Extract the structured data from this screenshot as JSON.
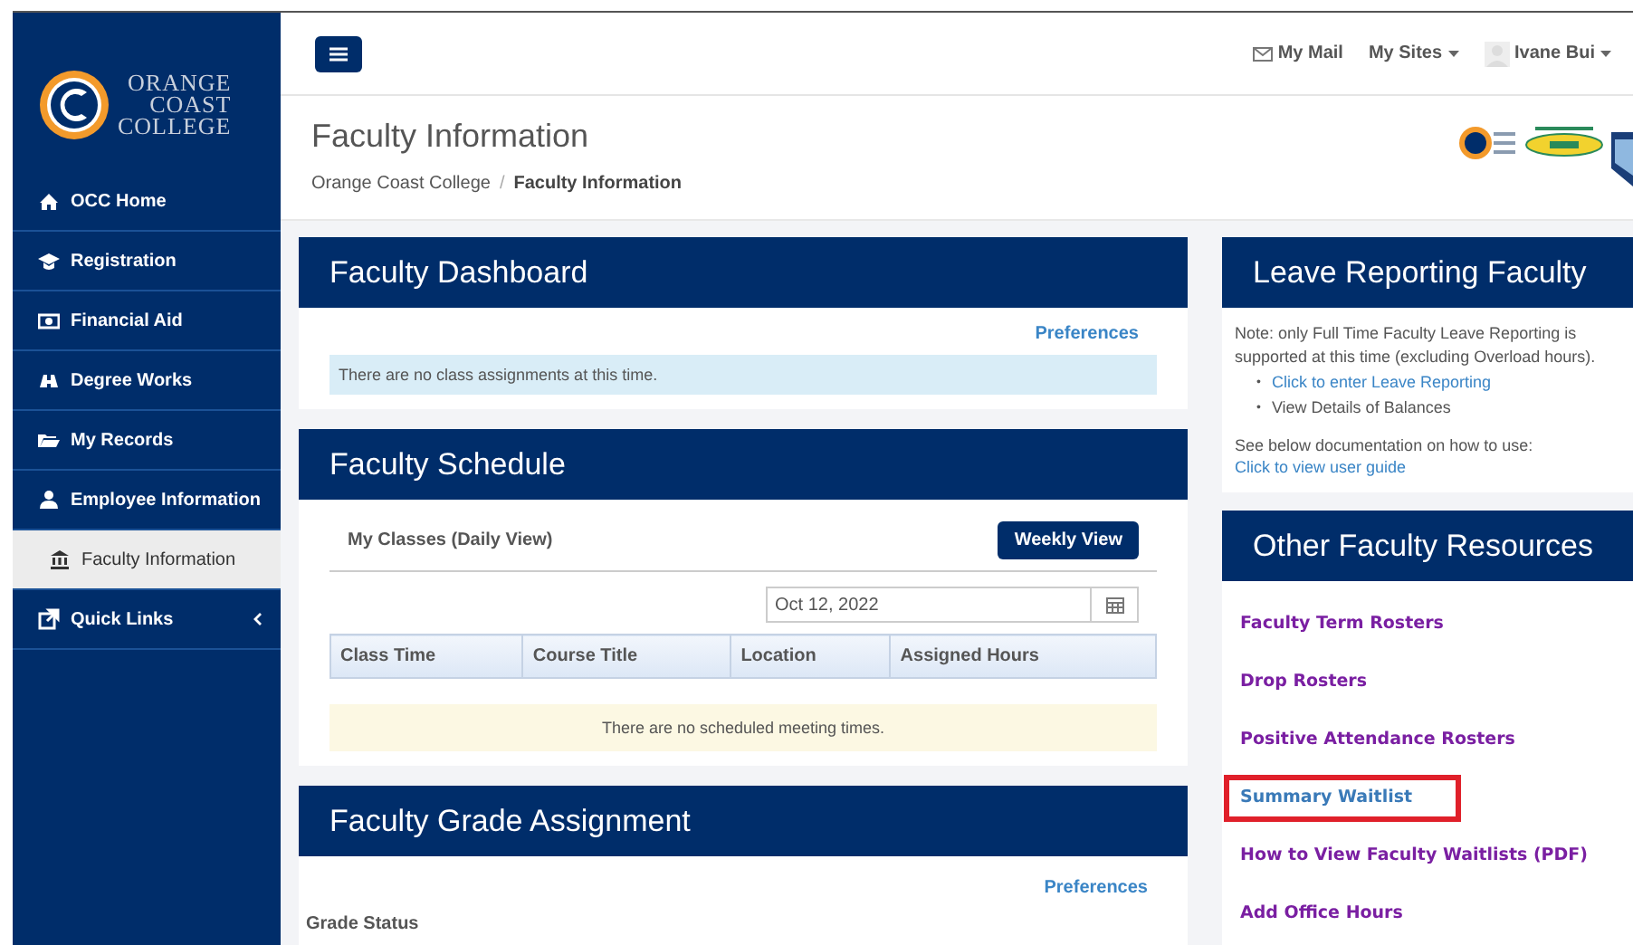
{
  "sidebar": {
    "logo_lines": [
      "ORANGE",
      "COAST",
      "COLLEGE"
    ],
    "items": [
      {
        "label": "OCC Home",
        "selected": false,
        "kind": "link"
      },
      {
        "label": "Registration",
        "selected": false,
        "kind": "link"
      },
      {
        "label": "Financial Aid",
        "selected": false,
        "kind": "link"
      },
      {
        "label": "Degree Works",
        "selected": false,
        "kind": "link"
      },
      {
        "label": "My Records",
        "selected": false,
        "kind": "link"
      },
      {
        "label": "Employee Information",
        "selected": false,
        "kind": "link"
      },
      {
        "label": "Faculty Information",
        "selected": true,
        "kind": "link"
      },
      {
        "label": "Quick Links",
        "selected": false,
        "kind": "submenu"
      }
    ]
  },
  "top_nav": {
    "mail": "My Mail",
    "sites": "My Sites",
    "user": "Ivane Bui"
  },
  "page_header": {
    "title": "Faculty Information",
    "breadcrumb": [
      "Orange Coast College",
      "Faculty Information"
    ],
    "separator": "/"
  },
  "faculty_dashboard": {
    "title": "Faculty Dashboard",
    "preferences": "Preferences",
    "alert": "There are no class assignments at this time."
  },
  "faculty_schedule": {
    "title": "Faculty Schedule",
    "subtitle": "My Classes (Daily View)",
    "button": "Weekly View",
    "date": "Oct 12, 2022",
    "columns": [
      "Class Time",
      "Course Title",
      "Location",
      "Assigned Hours"
    ],
    "empty_message": "There are no scheduled meeting times."
  },
  "faculty_grade_assignment": {
    "title": "Faculty Grade Assignment",
    "preferences": "Preferences",
    "label": "Grade Status"
  },
  "leave_reporting": {
    "title": "Leave Reporting Faculty",
    "note": "Note: only Full Time Faculty Leave Reporting is supported at this time (excluding Overload hours).",
    "bullet": "•",
    "items": [
      {
        "label": "Click to enter Leave Reporting",
        "kind": "link"
      },
      {
        "label": "View Details of Balances",
        "kind": "text"
      }
    ],
    "guide_text": "See below documentation on how to use:",
    "guide_link": "Click to view user guide"
  },
  "other_resources": {
    "title": "Other Faculty Resources",
    "links": [
      {
        "label": "Faculty Term Rosters",
        "visited": true,
        "highlighted": false
      },
      {
        "label": "Drop Rosters",
        "visited": true,
        "highlighted": false
      },
      {
        "label": "Positive Attendance Rosters",
        "visited": true,
        "highlighted": false
      },
      {
        "label": "Summary Waitlist",
        "visited": false,
        "highlighted": true
      },
      {
        "label": "How to View Faculty Waitlists (PDF)",
        "visited": true,
        "highlighted": false
      },
      {
        "label": "Add Office Hours",
        "visited": true,
        "highlighted": false
      }
    ]
  }
}
